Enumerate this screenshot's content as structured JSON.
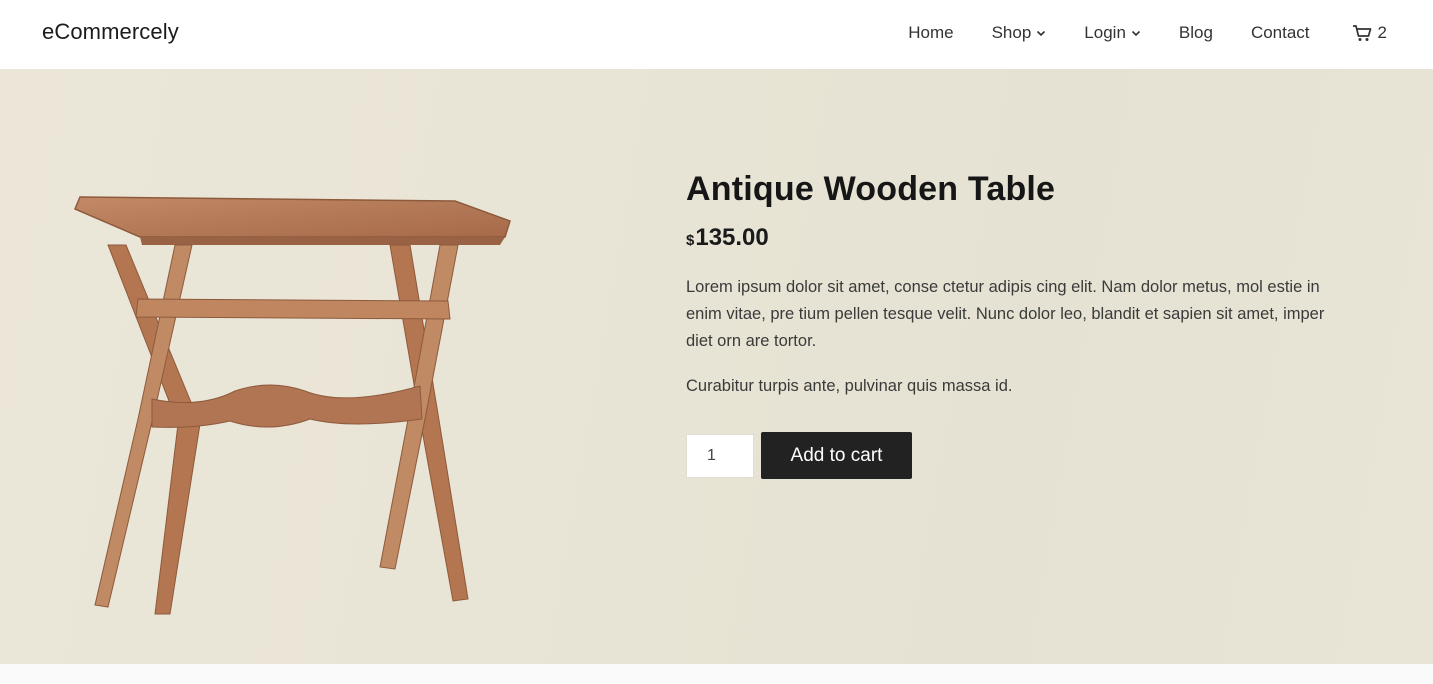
{
  "header": {
    "brand": "eCommercely",
    "nav": [
      {
        "label": "Home",
        "dropdown": false
      },
      {
        "label": "Shop",
        "dropdown": true
      },
      {
        "label": "Login",
        "dropdown": true
      },
      {
        "label": "Blog",
        "dropdown": false
      },
      {
        "label": "Contact",
        "dropdown": false
      }
    ],
    "cart_count": "2",
    "cart_icon": "cart-icon"
  },
  "product": {
    "title": "Antique Wooden Table",
    "currency_symbol": "$",
    "price": "135.00",
    "description": "Lorem ipsum dolor sit amet, conse ctetur adipis cing elit. Nam dolor metus, mol estie in enim vitae, pre tium pellen tesque velit. Nunc dolor leo, blandit et sapien sit amet, imper diet orn are tortor.",
    "description_2": "Curabitur turpis ante, pulvinar quis massa id.",
    "quantity": "1",
    "add_to_cart_label": "Add to cart"
  },
  "colors": {
    "background": "#e9e5d6",
    "button": "#222222",
    "wood": "#b67a57"
  }
}
